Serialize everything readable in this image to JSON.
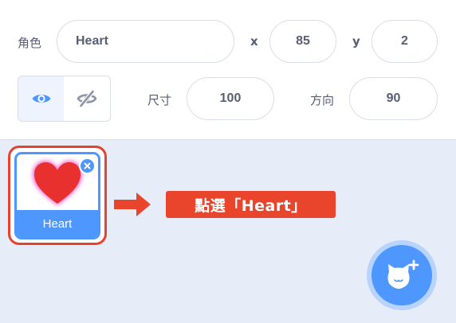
{
  "sprite_info": {
    "sprite_label": "角色",
    "sprite_name": "Heart",
    "x_label": "x",
    "x_value": "85",
    "y_label": "y",
    "y_value": "2",
    "size_label": "尺寸",
    "size_value": "100",
    "direction_label": "方向",
    "direction_value": "90",
    "show_icon": "eye-icon",
    "hide_icon": "eye-slash-icon"
  },
  "sprite_list": {
    "items": [
      {
        "name": "Heart",
        "selected": true,
        "icon": "heart-icon"
      }
    ]
  },
  "annotation": {
    "text": "點選「Heart」",
    "color": "#e8452c"
  },
  "choose_sprite": {
    "icon": "cat-plus-icon"
  },
  "colors": {
    "accent": "#4d97ff",
    "highlight": "#e8412d",
    "text": "#575e75"
  }
}
